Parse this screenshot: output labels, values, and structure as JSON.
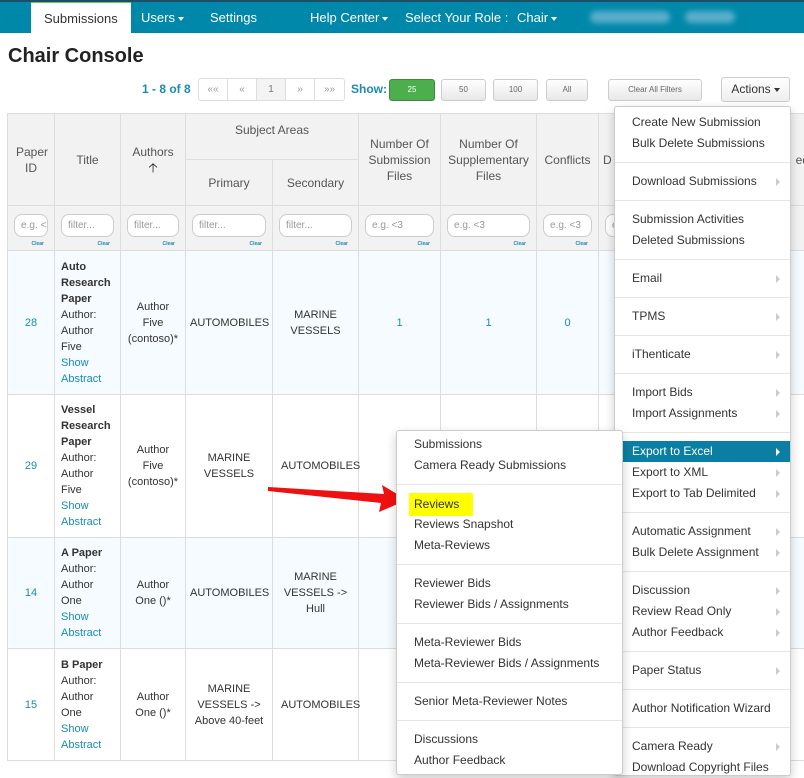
{
  "nav": {
    "tabs": [
      "Submissions",
      "Users",
      "Settings"
    ],
    "help": "Help Center",
    "role_label": "Select Your Role :",
    "role": "Chair"
  },
  "page": {
    "title": "Chair Console"
  },
  "toolbar": {
    "count": "1 - 8 of 8",
    "pager": [
      "««",
      "«",
      "1",
      "»",
      "»»"
    ],
    "show_label": "Show:",
    "sizes": [
      "25",
      "50",
      "100",
      "All"
    ],
    "active_size": "25",
    "clear_filters": "Clear All Filters",
    "actions": "Actions"
  },
  "colors": {
    "nav": "#0088aa",
    "accent": "#1a8bb3",
    "highlight": "#ffff00",
    "active_menu": "#0b7fa3",
    "arrow": "#ee1111"
  },
  "table": {
    "headers": {
      "paper_id": "Paper ID",
      "title": "Title",
      "authors": "Authors",
      "sort_icon": "arrow-up",
      "subject_areas": "Subject Areas",
      "primary": "Primary",
      "secondary": "Secondary",
      "sub_files": "Number Of Submission Files",
      "supp_files": "Number Of Supplementary Files",
      "conflicts": "Conflicts",
      "partial1": "D C",
      "partial2": "ed"
    },
    "filters": {
      "eg": "e.g. <3",
      "filter": "filter...",
      "clear": "Clear"
    },
    "rows": [
      {
        "id": "28",
        "title": "Auto Research Paper",
        "author_label": "Author:",
        "author": "Author Five",
        "abstract": "Show Abstract",
        "authors": "Author Five (contoso)*",
        "primary": "AUTOMOBILES",
        "secondary": "MARINE VESSELS",
        "sub_files": "1",
        "supp_files": "1",
        "conflicts": "0"
      },
      {
        "id": "29",
        "title": "Vessel Research Paper",
        "author_label": "Author:",
        "author": "Author Five",
        "abstract": "Show Abstract",
        "authors": "Author Five (contoso)*",
        "primary": "MARINE VESSELS",
        "secondary": "AUTOMOBILES"
      },
      {
        "id": "14",
        "title": "A Paper",
        "author_label": "Author:",
        "author": "Author One",
        "abstract": "Show Abstract",
        "authors": "Author One ()*",
        "primary": "AUTOMOBILES",
        "secondary": "MARINE VESSELS -> Hull"
      },
      {
        "id": "15",
        "title": "B Paper",
        "author_label": "Author:",
        "author": "Author One",
        "abstract": "Show Abstract",
        "authors": "Author One ()*",
        "primary": "MARINE VESSELS -> Above 40-feet",
        "secondary": "AUTOMOBILES"
      }
    ]
  },
  "actions_menu": [
    [
      {
        "label": "Create New Submission"
      },
      {
        "label": "Bulk Delete Submissions"
      }
    ],
    [
      {
        "label": "Download Submissions",
        "sub": true
      }
    ],
    [
      {
        "label": "Submission Activities"
      },
      {
        "label": "Deleted Submissions"
      }
    ],
    [
      {
        "label": "Email",
        "sub": true
      }
    ],
    [
      {
        "label": "TPMS",
        "sub": true
      }
    ],
    [
      {
        "label": "iThenticate",
        "sub": true
      }
    ],
    [
      {
        "label": "Import Bids",
        "sub": true
      },
      {
        "label": "Import Assignments",
        "sub": true
      }
    ],
    [
      {
        "label": "Export to Excel",
        "sub": true,
        "active": true
      },
      {
        "label": "Export to XML",
        "sub": true
      },
      {
        "label": "Export to Tab Delimited",
        "sub": true
      }
    ],
    [
      {
        "label": "Automatic Assignment",
        "sub": true
      },
      {
        "label": "Bulk Delete Assignment",
        "sub": true
      }
    ],
    [
      {
        "label": "Discussion",
        "sub": true
      },
      {
        "label": "Review Read Only",
        "sub": true
      },
      {
        "label": "Author Feedback",
        "sub": true
      }
    ],
    [
      {
        "label": "Paper Status",
        "sub": true
      }
    ],
    [
      {
        "label": "Author Notification Wizard"
      }
    ],
    [
      {
        "label": "Camera Ready",
        "sub": true
      },
      {
        "label": "Download Copyright Files"
      }
    ]
  ],
  "export_submenu": [
    [
      {
        "label": "Submissions"
      },
      {
        "label": "Camera Ready Submissions"
      }
    ],
    [
      {
        "label": "Reviews",
        "highlighted": true
      },
      {
        "label": "Reviews Snapshot"
      },
      {
        "label": "Meta-Reviews"
      }
    ],
    [
      {
        "label": "Reviewer Bids"
      },
      {
        "label": "Reviewer Bids / Assignments"
      }
    ],
    [
      {
        "label": "Meta-Reviewer Bids"
      },
      {
        "label": "Meta-Reviewer Bids / Assignments"
      }
    ],
    [
      {
        "label": "Senior Meta-Reviewer Notes"
      }
    ],
    [
      {
        "label": "Discussions"
      },
      {
        "label": "Author Feedback"
      }
    ]
  ]
}
